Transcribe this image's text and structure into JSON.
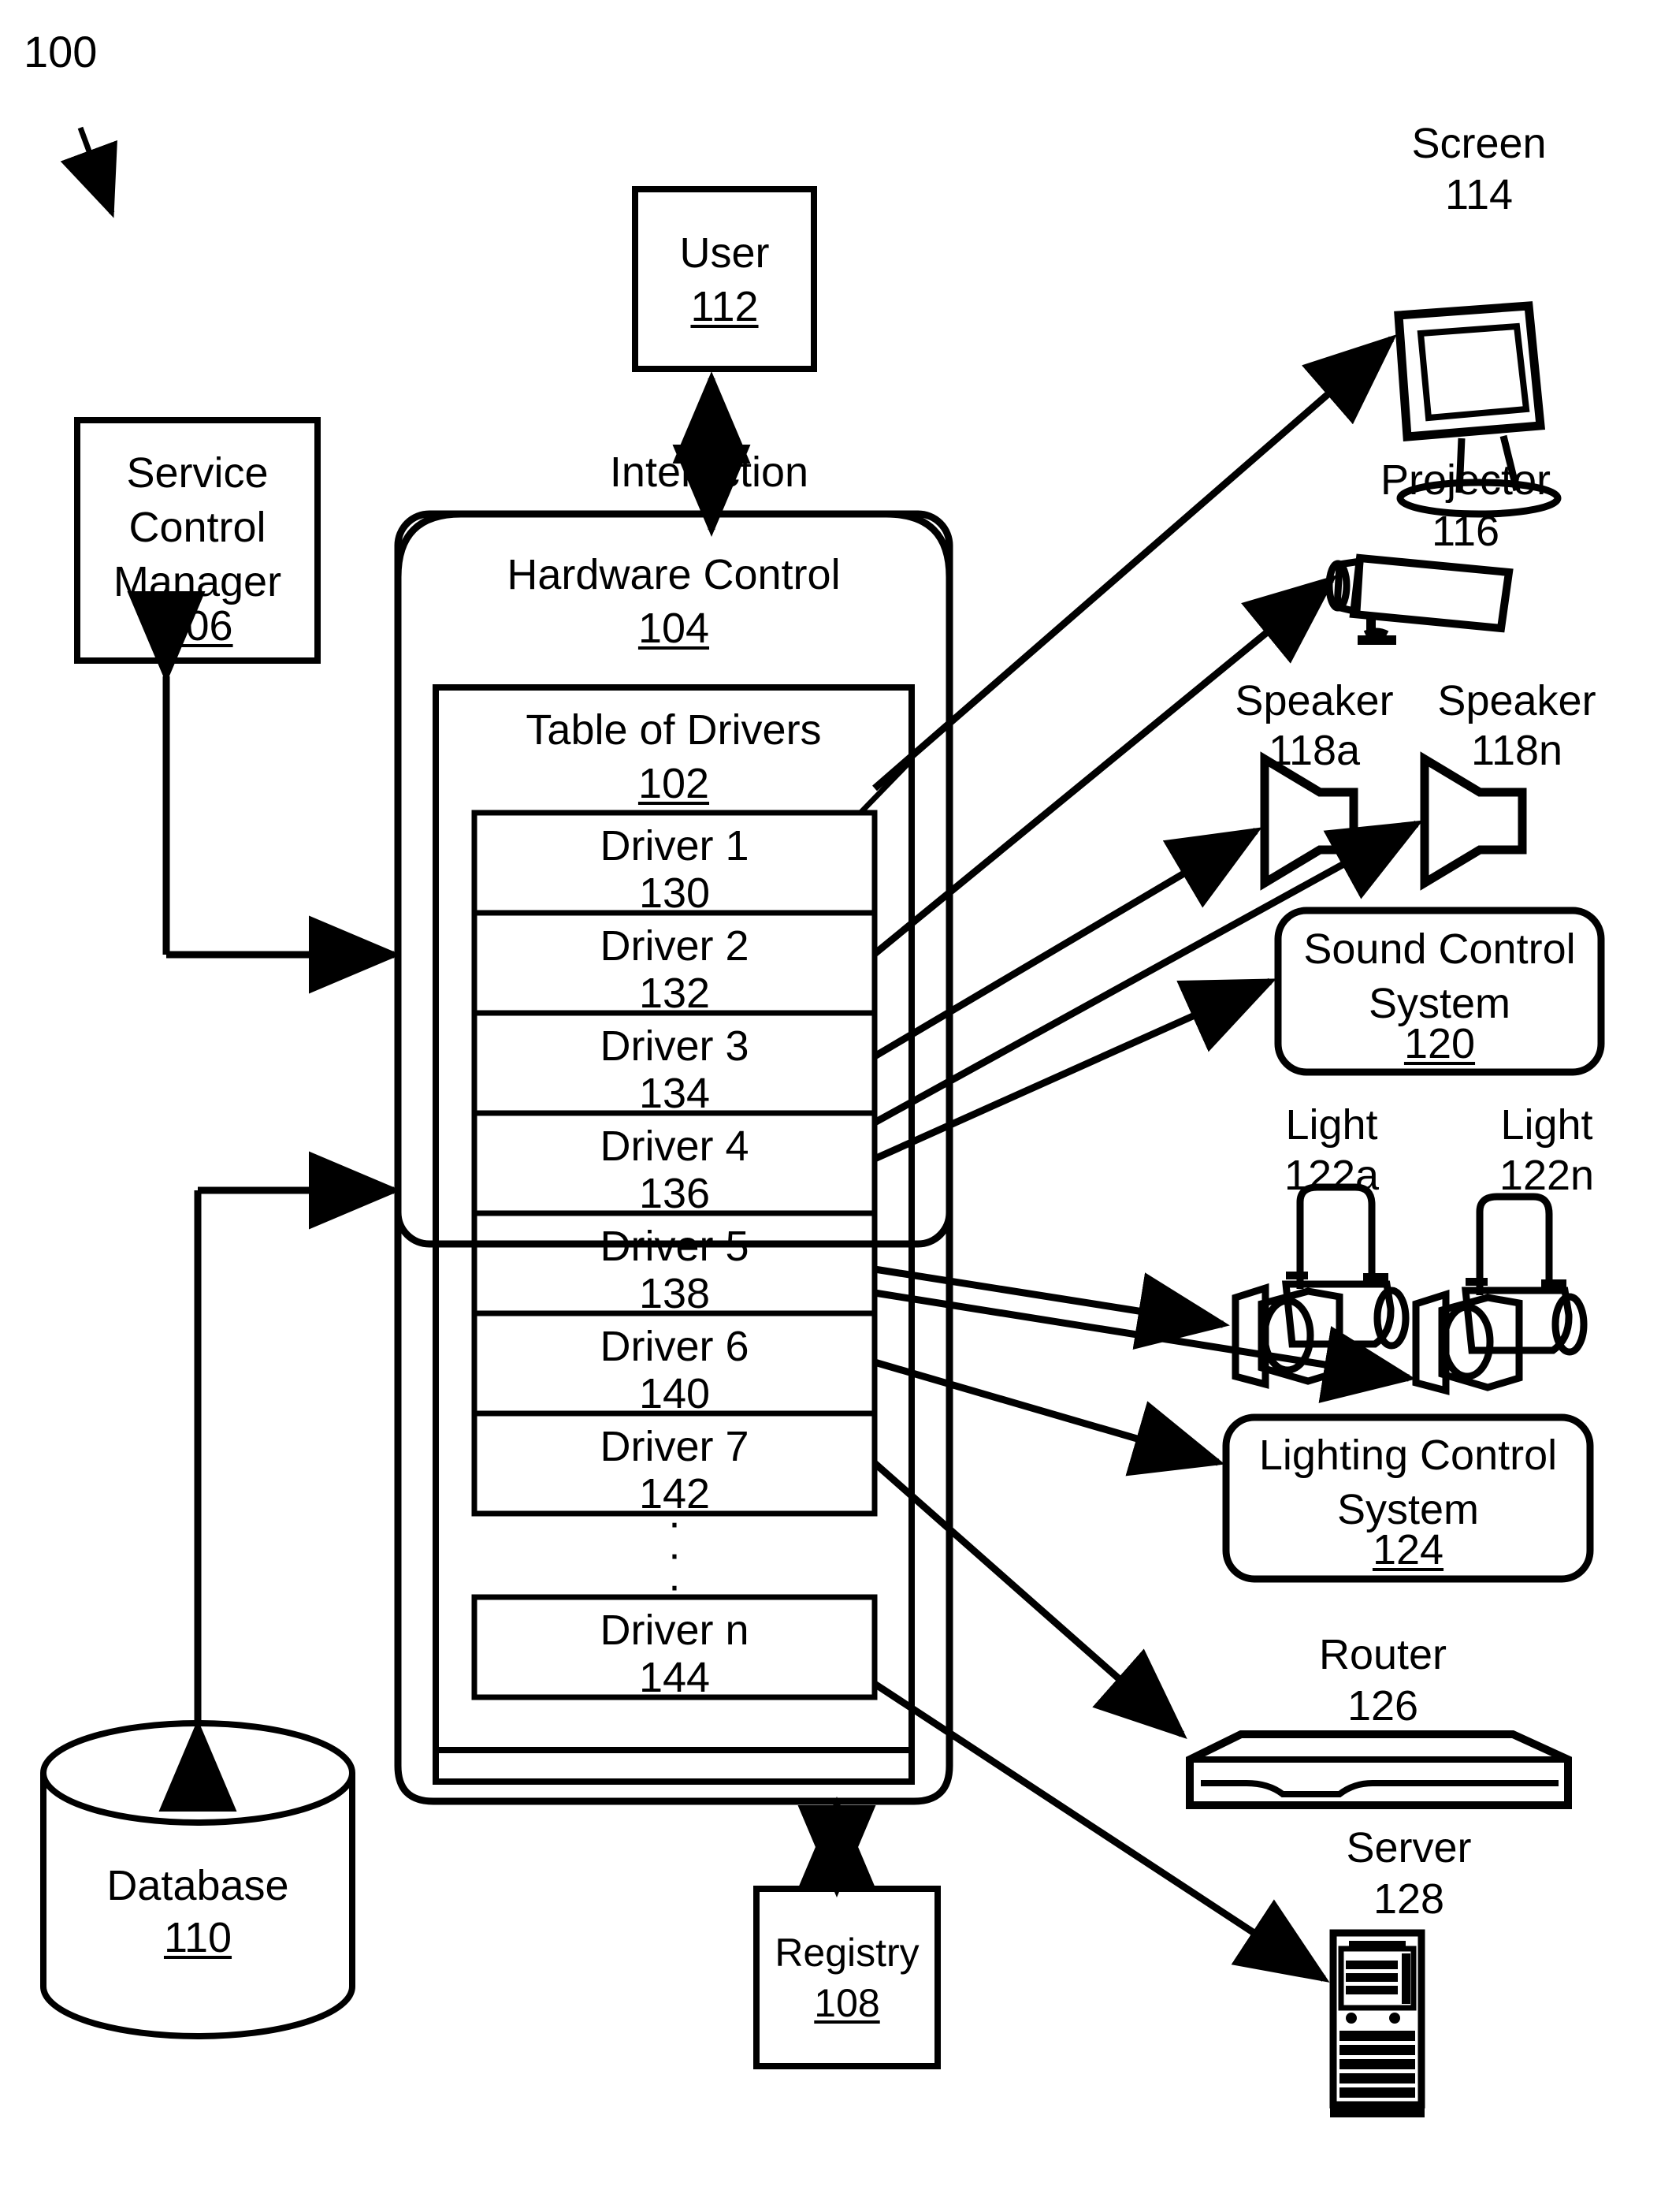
{
  "figure": {
    "reference_numeral": "100",
    "title_label": "100"
  },
  "nodes": {
    "service_control_manager": {
      "label": "Service\nControl\nManager",
      "ref": "106"
    },
    "user": {
      "label": "User",
      "ref": "112"
    },
    "interaction": {
      "label": "Interaction"
    },
    "hardware_control": {
      "label": "Hardware Control",
      "ref": "104"
    },
    "table_of_drivers": {
      "label": "Table of Drivers",
      "ref": "102"
    },
    "database": {
      "label": "Database",
      "ref": "110"
    },
    "registry": {
      "label": "Registry",
      "ref": "108"
    },
    "screen": {
      "label": "Screen",
      "ref": "114"
    },
    "projector": {
      "label": "Projector",
      "ref": "116"
    },
    "speaker_a": {
      "label": "Speaker",
      "ref": "118a"
    },
    "speaker_n": {
      "label": "Speaker",
      "ref": "118n"
    },
    "sound_control_system": {
      "label": "Sound Control\nSystem",
      "ref": "120"
    },
    "light_a": {
      "label": "Light",
      "ref": "122a"
    },
    "light_n": {
      "label": "Light",
      "ref": "122n"
    },
    "lighting_control_system": {
      "label": "Lighting Control\nSystem",
      "ref": "124"
    },
    "router": {
      "label": "Router",
      "ref": "126"
    },
    "server": {
      "label": "Server",
      "ref": "128"
    }
  },
  "drivers": [
    {
      "label": "Driver 1",
      "ref": "130"
    },
    {
      "label": "Driver 2",
      "ref": "132"
    },
    {
      "label": "Driver 3",
      "ref": "134"
    },
    {
      "label": "Driver 4",
      "ref": "136"
    },
    {
      "label": "Driver 5",
      "ref": "138"
    },
    {
      "label": "Driver 6",
      "ref": "140"
    },
    {
      "label": "Driver 7",
      "ref": "142"
    }
  ],
  "driver_ellipsis": "·",
  "driver_last": {
    "label": "Driver n",
    "ref": "144"
  },
  "colors": {
    "ink": "#000000",
    "paper": "#ffffff"
  }
}
